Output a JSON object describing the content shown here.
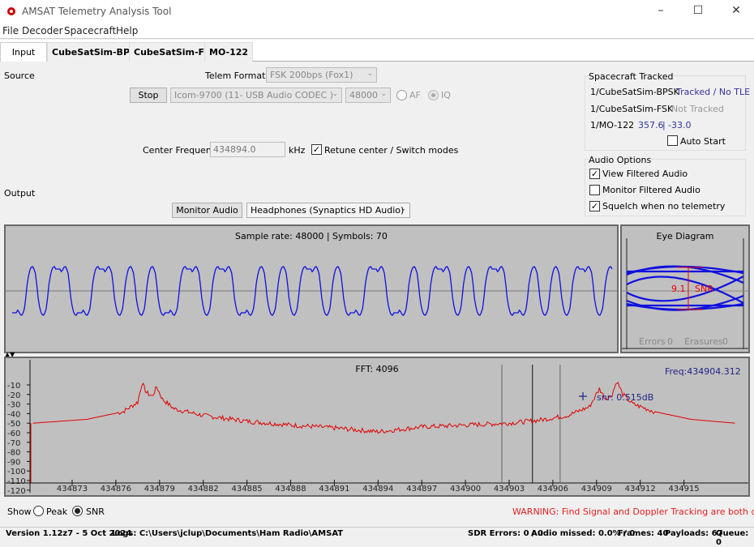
{
  "window": {
    "title": "AMSAT Telemetry Analysis Tool",
    "icon": "amsat-logo-icon",
    "controls": [
      "minimize-icon",
      "maximize-icon",
      "close-icon"
    ]
  },
  "menu": [
    "File",
    "Decoder",
    "Spacecraft",
    "Help"
  ],
  "tabs": [
    {
      "label": "Input",
      "active": true
    },
    {
      "label": "CubeSatSim-BPSK"
    },
    {
      "label": "CubeSatSim-FSK"
    },
    {
      "label": "MO-122"
    }
  ],
  "source": {
    "label": "Source",
    "telem_format_label": "Telem Format:",
    "telem_format": "FSK 200bps (Fox1)",
    "stop": "Stop",
    "device": "Icom-9700 (11- USB Audio CODEC )",
    "rate": "48000",
    "af": "AF",
    "iq": "IQ",
    "iq_selected": true,
    "center_freq_label": "Center Frequency",
    "center_freq": "434894.0",
    "khz": "kHz",
    "retune_label": "Retune center / Switch modes",
    "retune_checked": true
  },
  "output": {
    "label": "Output",
    "monitor": "Monitor Audio",
    "device": "Headphones (Synaptics HD Audio)"
  },
  "tracked": {
    "title": "Spacecraft Tracked",
    "rows": [
      {
        "name": "1/CubeSatSim-BPSK",
        "status": "Tracked / No TLE",
        "color": "#333399"
      },
      {
        "name": "1/CubeSatSim-FSK",
        "status": "Not Tracked",
        "color": "#999999"
      },
      {
        "name": "1/MO-122",
        "az": "357.6",
        "sep": "|",
        "el": "-33.0",
        "color": "#333399"
      }
    ],
    "auto_start": "Auto Start",
    "auto_start_checked": false
  },
  "audio_options": {
    "title": "Audio Options",
    "items": [
      {
        "label": "View Filtered Audio",
        "checked": true
      },
      {
        "label": "Monitor Filtered Audio",
        "checked": false
      },
      {
        "label": "Squelch when no telemetry",
        "checked": true
      }
    ]
  },
  "audio_panel": {
    "title": "Sample rate: 48000 | Symbols: 70",
    "bits": "0101100110101001101100101011010011001011010110010101101"
  },
  "eye": {
    "title": "Eye Diagram",
    "snr": "9.1",
    "snr_label": "SNR",
    "errors_label": "Errors",
    "errors": "0",
    "erasures_label": "Erasures",
    "erasures": "0"
  },
  "fft": {
    "title": "FFT: 4096",
    "freq": "Freq:434904.312",
    "snr_text": "snr: 0.515dB"
  },
  "chart_data": {
    "type": "line",
    "ylim": [
      -120,
      0
    ],
    "yticks": [
      -10,
      -20,
      -30,
      -40,
      -50,
      -60,
      -70,
      -80,
      -90,
      -100,
      -110,
      -120
    ],
    "xticks": [
      "434873",
      "434876",
      "434879",
      "434882",
      "434885",
      "434888",
      "434891",
      "434894",
      "434897",
      "434900",
      "434903",
      "434906",
      "434909",
      "434912",
      "434915"
    ],
    "series": [
      {
        "color": "#e00000",
        "x": [
          434870.3,
          434874,
          434876.5,
          434877.5,
          434877.8,
          434878.1,
          434878.5,
          434878.8,
          434879.2,
          434880,
          434882,
          434885,
          434888,
          434891,
          434894,
          434897,
          434900,
          434903,
          434905,
          434907,
          434908.5,
          434909.2,
          434909.6,
          434910,
          434910.4,
          434910.8,
          434911.5,
          434913,
          434915.5,
          434918.5
        ],
        "y": [
          -50,
          -46,
          -38,
          -28,
          -8,
          -18,
          -22,
          -12,
          -25,
          -35,
          -42,
          -48,
          -52,
          -55,
          -59,
          -54,
          -52,
          -50,
          -47,
          -42,
          -33,
          -14,
          -24,
          -22,
          -6,
          -20,
          -30,
          -38,
          -46,
          -50
        ]
      }
    ],
    "markers": [
      434902.5,
      434904.6,
      434906.5
    ]
  },
  "show": {
    "label": "Show",
    "peak": "Peak",
    "snr": "SNR",
    "snr_selected": true,
    "warning": "WARNING: Find Signal and Doppler Tracking are both disabled"
  },
  "status": {
    "version": "Version 1.12z7 - 5 Oct 2024",
    "logs": "Logs: C:\\Users\\jclup\\Documents\\Ham Radio\\AMSAT",
    "sdr": "SDR Errors: 0 / 0",
    "audio": "Audio missed: 0.0% / 0",
    "frames": "Frames: 40",
    "payloads": "Payloads: 67",
    "queue": "Queue: 0"
  }
}
